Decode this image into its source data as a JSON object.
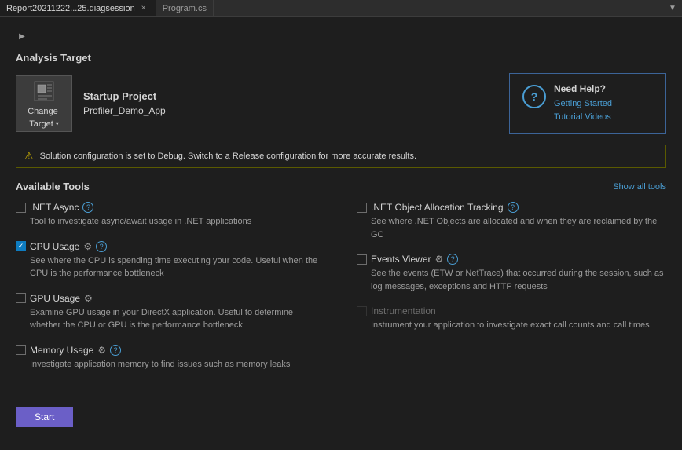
{
  "titlebar": {
    "tabs": [
      {
        "label": "Report20211222...25.diagsession",
        "active": true,
        "closable": true
      },
      {
        "label": "Program.cs",
        "active": false,
        "closable": false
      }
    ],
    "scroll_btn": "▼"
  },
  "analysis_target": {
    "section_title": "Analysis Target",
    "project_icon_alt": "project-icon",
    "change_target_label": "Change",
    "change_target_sublabel": "Target",
    "dropdown_arrow": "▾",
    "startup_project_label": "Startup Project",
    "project_name": "Profiler_Demo_App"
  },
  "help_box": {
    "title": "Need Help?",
    "link1": "Getting Started",
    "link2": "Tutorial Videos"
  },
  "warning": {
    "text": "Solution configuration is set to Debug. Switch to a Release configuration for more accurate results."
  },
  "available_tools": {
    "section_title": "Available Tools",
    "show_all_label": "Show all tools",
    "tools_left": [
      {
        "id": "net-async",
        "name": ".NET Async",
        "checked": false,
        "disabled": false,
        "has_settings": false,
        "has_help": true,
        "desc": "Tool to investigate async/await usage in .NET applications"
      },
      {
        "id": "cpu-usage",
        "name": "CPU Usage",
        "checked": true,
        "disabled": false,
        "has_settings": true,
        "has_help": true,
        "desc": "See where the CPU is spending time executing your code. Useful when the CPU is the performance bottleneck"
      },
      {
        "id": "gpu-usage",
        "name": "GPU Usage",
        "checked": false,
        "disabled": false,
        "has_settings": true,
        "has_help": false,
        "desc": "Examine GPU usage in your DirectX application. Useful to determine whether the CPU or GPU is the performance bottleneck"
      },
      {
        "id": "memory-usage",
        "name": "Memory Usage",
        "checked": false,
        "disabled": false,
        "has_settings": true,
        "has_help": true,
        "desc": "Investigate application memory to find issues such as memory leaks"
      }
    ],
    "tools_right": [
      {
        "id": "net-object-allocation",
        "name": ".NET Object Allocation Tracking",
        "checked": false,
        "disabled": false,
        "has_settings": false,
        "has_help": true,
        "desc": "See where .NET Objects are allocated and when they are reclaimed by the GC"
      },
      {
        "id": "events-viewer",
        "name": "Events Viewer",
        "checked": false,
        "disabled": false,
        "has_settings": true,
        "has_help": true,
        "desc": "See the events (ETW or NetTrace) that occurred during the session, such as log messages, exceptions and HTTP requests"
      },
      {
        "id": "instrumentation",
        "name": "Instrumentation",
        "checked": false,
        "disabled": true,
        "has_settings": false,
        "has_help": false,
        "desc": "Instrument your application to investigate exact call counts and call times"
      }
    ]
  },
  "start_button_label": "Start"
}
